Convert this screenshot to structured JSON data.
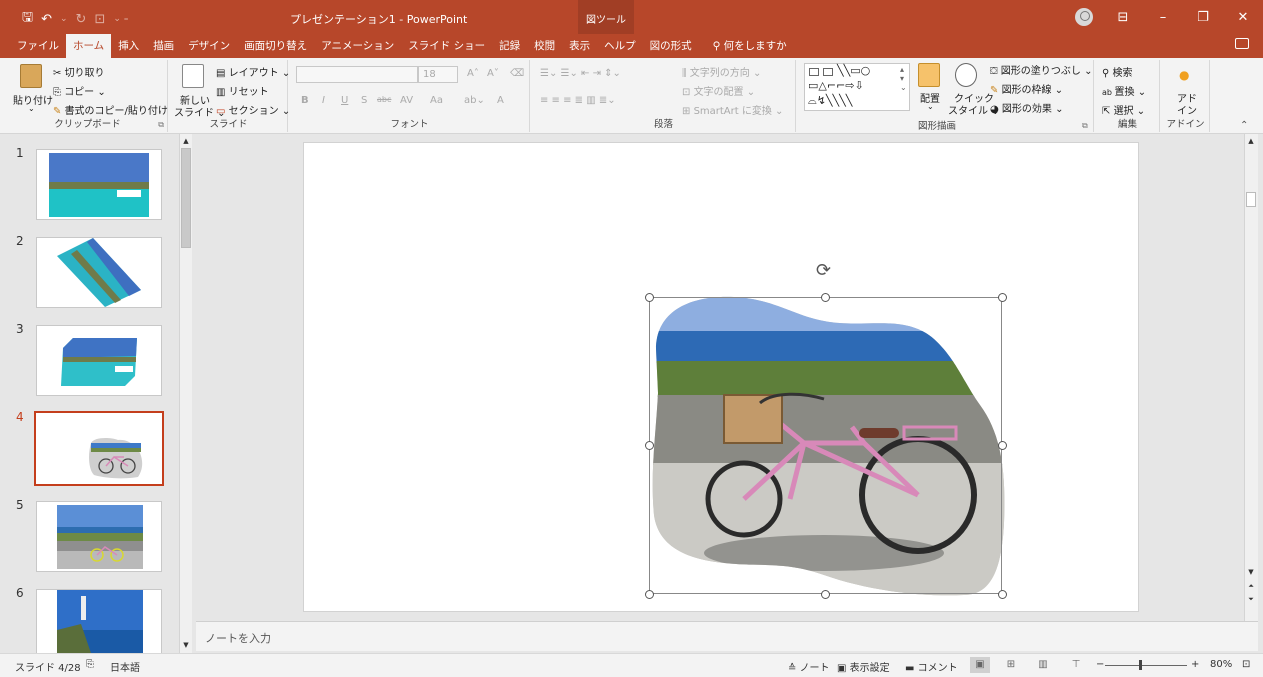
{
  "app": {
    "title": "プレゼンテーション1  -  PowerPoint",
    "tool_context_tab": "図ツール",
    "qat": [
      "save-icon",
      "undo-icon",
      "redo-icon",
      "present-icon",
      "customize-icon"
    ],
    "window_controls": [
      "ribbon-display-icon",
      "minimize-icon",
      "restore-icon",
      "close-icon"
    ]
  },
  "tabs": [
    "ファイル",
    "ホーム",
    "挿入",
    "描画",
    "デザイン",
    "画面切り替え",
    "アニメーション",
    "スライド ショー",
    "記録",
    "校閲",
    "表示",
    "ヘルプ",
    "図の形式"
  ],
  "active_tab": "ホーム",
  "tell_me": "何をしますか",
  "ribbon": {
    "clipboard": {
      "label": "クリップボード",
      "paste": "貼り付け",
      "cut": "切り取り",
      "copy": "コピー",
      "format_painter": "書式のコピー/貼り付け"
    },
    "slides": {
      "label": "スライド",
      "new_slide_1": "新しい",
      "new_slide_2": "スライド",
      "layout": "レイアウト",
      "reset": "リセット",
      "section": "セクション"
    },
    "font": {
      "label": "フォント",
      "font_size": "18",
      "bold": "B",
      "italic": "I",
      "underline": "U",
      "shadow": "S",
      "strike": "abc",
      "spacing": "AV",
      "case": "Aa",
      "color": "A"
    },
    "paragraph": {
      "label": "段落",
      "text_direction": "文字列の方向",
      "align_text": "文字の配置",
      "smartart": "SmartArt に変換"
    },
    "drawing": {
      "label": "図形描画",
      "arrange": "配置",
      "quick_styles_1": "クイック",
      "quick_styles_2": "スタイル",
      "fill": "図形の塗りつぶし",
      "outline": "図形の枠線",
      "effects": "図形の効果"
    },
    "editing": {
      "label": "編集",
      "find": "検索",
      "replace": "置換",
      "select": "選択"
    },
    "addins": {
      "label": "アドイン",
      "button_1": "アド",
      "button_2": "イン"
    }
  },
  "slides": [
    {
      "num": "1",
      "desc": "turquoise-bay-boat"
    },
    {
      "num": "2",
      "desc": "rotated-bay"
    },
    {
      "num": "3",
      "desc": "hexagon-bay"
    },
    {
      "num": "4",
      "desc": "bicycle-blob",
      "active": true
    },
    {
      "num": "5",
      "desc": "bicycle-sea"
    },
    {
      "num": "6",
      "desc": "lighthouse"
    }
  ],
  "notes_placeholder": "ノートを入力",
  "status": {
    "slide_counter": "スライド 4/28",
    "language": "日本語",
    "notes": "ノート",
    "display_settings": "表示設定",
    "comments": "コメント",
    "zoom": "80%",
    "zoom_minus": "−",
    "zoom_plus": "+"
  },
  "colors": {
    "accent": "#b7472a",
    "active_outline": "#c43e1c"
  }
}
